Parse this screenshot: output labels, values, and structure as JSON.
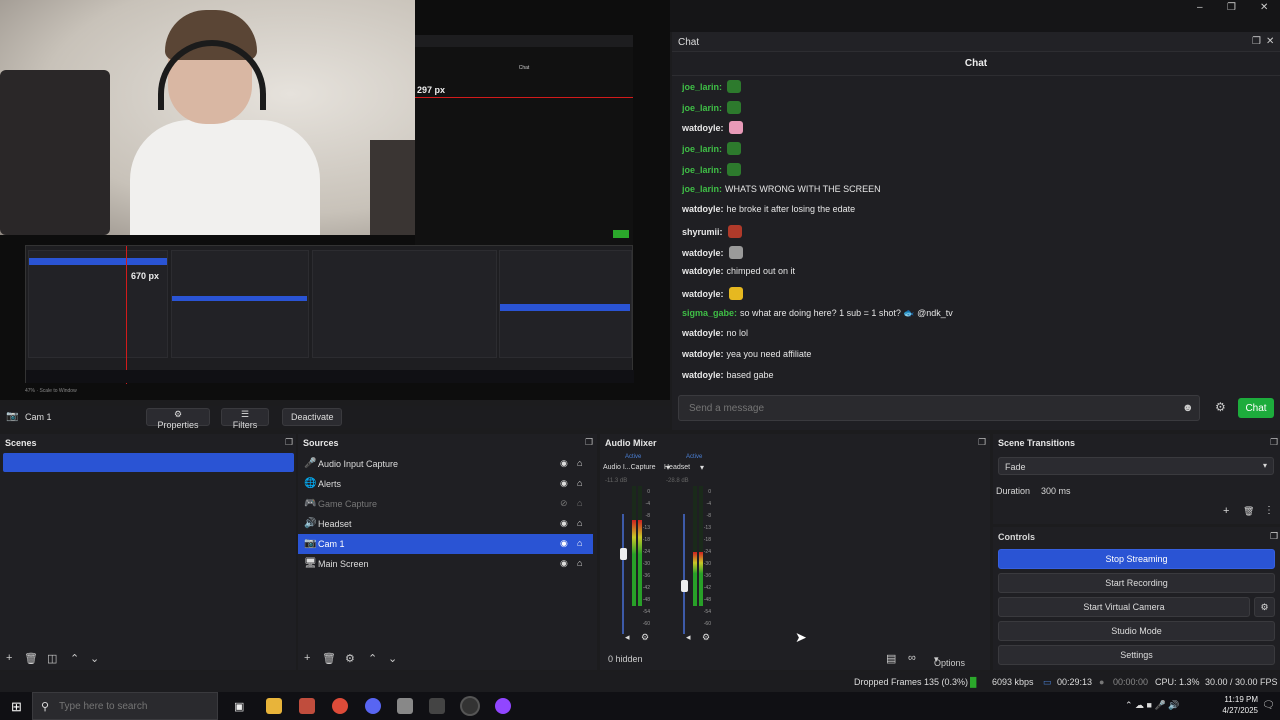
{
  "window": {
    "minimize": "–",
    "restore": "❐",
    "close": "✕"
  },
  "preview": {
    "nested_chat_label": "Chat",
    "measure_width": "297 px",
    "measure_height": "670 px",
    "scale_text": "47% · Scale to Window"
  },
  "chat": {
    "dock_title": "Chat",
    "header": "Chat",
    "messages": [
      {
        "user": "joe_larin:",
        "text": "",
        "color": "#3fbf46",
        "emote": "#2d7a2d"
      },
      {
        "user": "joe_larin:",
        "text": "",
        "color": "#3fbf46",
        "emote": "#2d7a2d"
      },
      {
        "user": "watdoyle:",
        "text": "",
        "color": "#e8e8e8",
        "emote": "#e89ab8"
      },
      {
        "user": "joe_larin:",
        "text": "",
        "color": "#3fbf46",
        "emote": "#2d7a2d"
      },
      {
        "user": "joe_larin:",
        "text": "",
        "color": "#3fbf46",
        "emote": "#2d7a2d"
      },
      {
        "user": "joe_larin:",
        "text": "WHATS WRONG WITH THE SCREEN",
        "color": "#3fbf46",
        "emote": ""
      },
      {
        "user": "watdoyle:",
        "text": "he broke it after losing the edate",
        "color": "#e8e8e8",
        "emote": ""
      },
      {
        "user": "shyrumii:",
        "text": "",
        "color": "#e8e8e8",
        "emote": "#b03a2a"
      },
      {
        "user": "watdoyle:",
        "text": "",
        "color": "#e8e8e8",
        "emote": "#9a9a9a"
      },
      {
        "user": "watdoyle:",
        "text": "chimped out on it",
        "color": "#e8e8e8",
        "emote": ""
      },
      {
        "user": "watdoyle:",
        "text": "",
        "color": "#e8e8e8",
        "emote": "#e6b820"
      },
      {
        "user": "sigma_gabe:",
        "text": "so what are doing here? 1 sub = 1 shot? 🐟 @ndk_tv",
        "color": "#3fbf46",
        "emote": ""
      },
      {
        "user": "watdoyle:",
        "text": "no lol",
        "color": "#e8e8e8",
        "emote": ""
      },
      {
        "user": "watdoyle:",
        "text": "yea you need affiliate",
        "color": "#e8e8e8",
        "emote": ""
      },
      {
        "user": "watdoyle:",
        "text": "based gabe",
        "color": "#e8e8e8",
        "emote": ""
      }
    ],
    "input_placeholder": "Send a message",
    "send_label": "Chat",
    "emoji_icon": "☻",
    "settings_icon": "⚙",
    "popout_icon": "❐",
    "close_icon": "✕"
  },
  "context": {
    "source_name": "Cam 1",
    "properties": "Properties",
    "filters": "Filters",
    "deactivate": "Deactivate"
  },
  "scenes": {
    "title": "Scenes",
    "items": [
      {
        "name": ""
      }
    ]
  },
  "sources": {
    "title": "Sources",
    "items": [
      {
        "name": "Audio Input Capture",
        "icon": "🎤",
        "hidden": false,
        "selected": false
      },
      {
        "name": "Alerts",
        "icon": "🌐",
        "hidden": false,
        "selected": false
      },
      {
        "name": "Game Capture",
        "icon": "🎮",
        "hidden": true,
        "selected": false
      },
      {
        "name": "Headset",
        "icon": "🔊",
        "hidden": false,
        "selected": false
      },
      {
        "name": "Cam 1",
        "icon": "📷",
        "hidden": false,
        "selected": true
      },
      {
        "name": "Main Screen",
        "icon": "🖥",
        "hidden": false,
        "selected": false
      }
    ]
  },
  "audio_mixer": {
    "title": "Audio Mixer",
    "channels": [
      {
        "name": "Audio I...Capture",
        "status": "Active",
        "db": "-11.3 dB",
        "volume": 0.72
      },
      {
        "name": "Headset",
        "status": "Active",
        "db": "-28.8 dB",
        "volume": 0.45
      }
    ],
    "ticks": [
      "0",
      "-4",
      "-8",
      "-13",
      "-18",
      "-24",
      "-30",
      "-36",
      "-42",
      "-48",
      "-54",
      "-60"
    ],
    "hidden_label": "0 hidden",
    "options_label": "Options"
  },
  "transitions": {
    "title": "Scene Transitions",
    "selected": "Fade",
    "duration_label": "Duration",
    "duration_value": "300 ms"
  },
  "controls": {
    "title": "Controls",
    "stop_streaming": "Stop Streaming",
    "start_recording": "Start Recording",
    "start_virtual_camera": "Start Virtual Camera",
    "studio_mode": "Studio Mode",
    "settings": "Settings",
    "accent": "#2a54d4"
  },
  "status": {
    "dropped": "Dropped Frames 135 (0.3%)",
    "kbps": "6093 kbps",
    "stream_time": "00:29:13",
    "rec_time": "00:00:00",
    "cpu": "CPU: 1.3%",
    "fps": "30.00 / 30.00 FPS"
  },
  "taskbar": {
    "search_placeholder": "Type here to search",
    "time": "11:19 PM",
    "date": "4/27/2025"
  }
}
